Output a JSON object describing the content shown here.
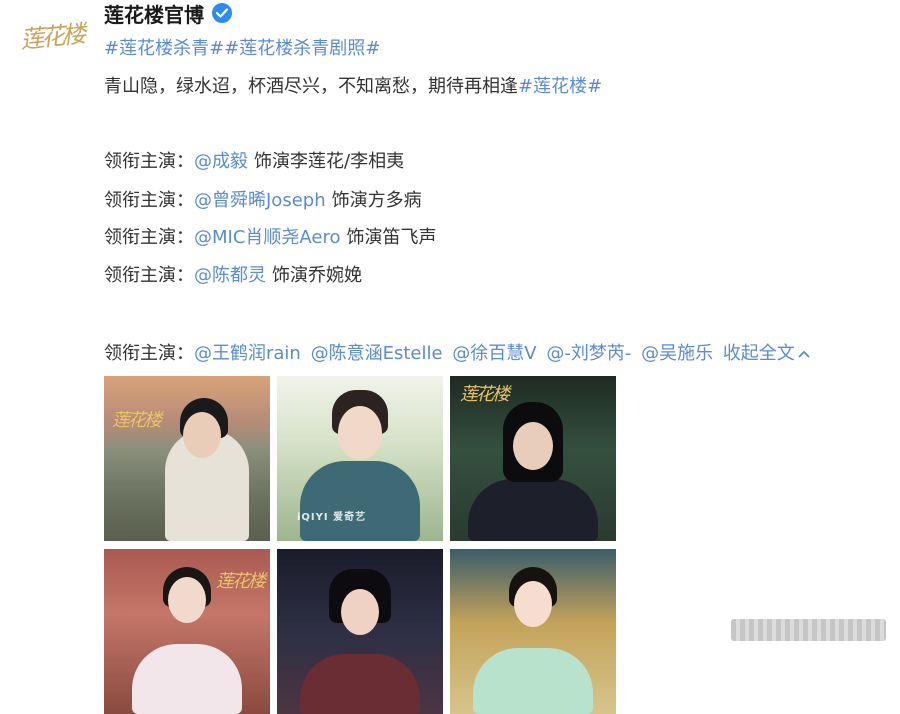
{
  "account": {
    "name": "莲花楼官博",
    "avatar_text": "莲花楼"
  },
  "post": {
    "hashtags": [
      "#莲花楼杀青#",
      "#莲花楼杀青剧照#"
    ],
    "caption": "青山隐，绿水迢，杯酒尽兴，不知离愁，期待再相逢",
    "caption_tag": "#莲花楼#",
    "cast": [
      {
        "prefix": "领衔主演：",
        "mention": "@成毅",
        "role": "饰演李莲花/李相夷"
      },
      {
        "prefix": "领衔主演：",
        "mention": "@曾舜晞Joseph",
        "role": "饰演方多病"
      },
      {
        "prefix": "领衔主演：",
        "mention": "@MIC肖顺尧Aero",
        "role": "饰演笛飞声"
      },
      {
        "prefix": "领衔主演：",
        "mention": "@陈都灵",
        "role": "饰演乔婉娩"
      }
    ],
    "supporting": {
      "prefix": "领衔主演：",
      "mentions": [
        "@王鹤润rain",
        "@陈意涵Estelle",
        "@徐百慧V",
        "@-刘梦芮-",
        "@吴施乐"
      ],
      "collapse_label": "收起全文",
      "collapse_icon": "chevron-up-icon"
    },
    "photo_watermark": "iQIYI 爱奇艺",
    "photo_logo": "莲花楼"
  },
  "colors": {
    "link": "#5b8bd6",
    "verified": "#2d8cf0",
    "logo_gold": "#c9a45a"
  }
}
